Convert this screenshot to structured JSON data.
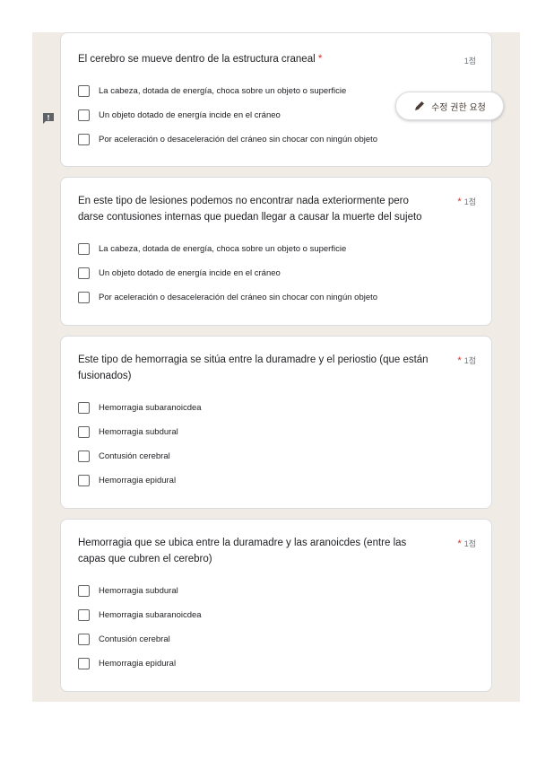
{
  "edit_request": {
    "label": "수정 권한 요청",
    "icon": "pencil-icon"
  },
  "feedback_icon": "feedback-icon",
  "questions": [
    {
      "title": "El cerebro se mueve dentro de la estructura craneal",
      "required_marker": "*",
      "points": "1점",
      "options": [
        "La cabeza, dotada de energía, choca sobre un objeto o superficie",
        "Un objeto dotado de energía incide en el cráneo",
        "Por aceleración o desaceleración del cráneo sin chocar con ningún objeto"
      ]
    },
    {
      "title_line1": "En este tipo de lesiones podemos no encontrar nada exteriormente pero",
      "title_line2": "darse contusiones internas que puedan llegar a causar la muerte del sujeto",
      "required_marker": "*",
      "points": "1점",
      "options": [
        "La cabeza, dotada de energía, choca sobre un objeto o superficie",
        "Un objeto dotado de energía incide en el cráneo",
        "Por aceleración o desaceleración del cráneo sin chocar con ningún objeto"
      ]
    },
    {
      "title_line1": "Este tipo de hemorragia se sitúa entre la duramadre y el periostio (que están",
      "title_line2": "fusionados)",
      "required_marker": "*",
      "points": "1점",
      "options": [
        "Hemorragia subaranoicdea",
        "Hemorragia subdural",
        "Contusión cerebral",
        "Hemorragia epidural"
      ]
    },
    {
      "title_line1": "Hemorragia que se ubica entre la duramadre y las aranoicdes (entre las",
      "title_line2": "capas que cubren el cerebro)",
      "required_marker": "*",
      "points": "1점",
      "options": [
        "Hemorragia subdural",
        "Hemorragia subaranoicdea",
        "Contusión cerebral",
        "Hemorragia epidural"
      ]
    }
  ]
}
